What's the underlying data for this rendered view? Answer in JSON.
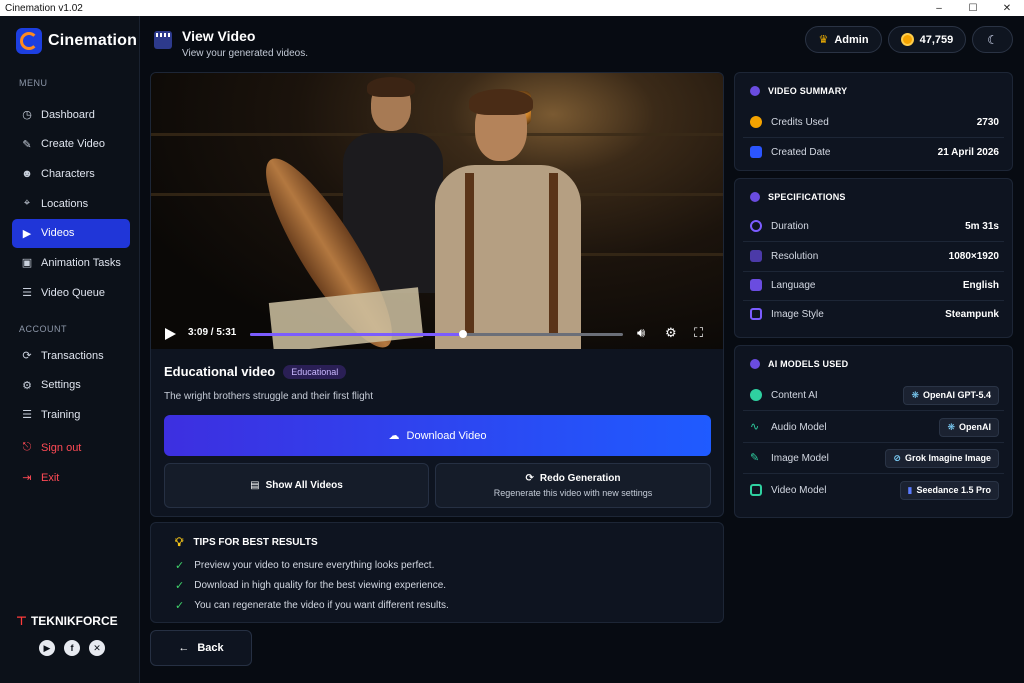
{
  "window": {
    "title": "Cinemation v1.02",
    "controls": [
      "–",
      "☐",
      "✕"
    ]
  },
  "sidebar": {
    "logo": "Cinemation",
    "menu_label": "MENU",
    "menu_items": [
      {
        "label": "Dashboard",
        "icon": "gauge-icon",
        "glyph": "◷"
      },
      {
        "label": "Create Video",
        "icon": "edit-icon",
        "glyph": "✎"
      },
      {
        "label": "Characters",
        "icon": "users-icon",
        "glyph": "☻"
      },
      {
        "label": "Locations",
        "icon": "location-pin-icon",
        "glyph": "⌖"
      },
      {
        "label": "Videos",
        "icon": "video-icon",
        "glyph": "▶",
        "active": true
      },
      {
        "label": "Animation Tasks",
        "icon": "image-icon",
        "glyph": "▣"
      },
      {
        "label": "Video Queue",
        "icon": "queue-icon",
        "glyph": "☰"
      }
    ],
    "account_label": "ACCOUNT",
    "account_items": [
      {
        "label": "Transactions",
        "icon": "transactions-icon",
        "glyph": "⟳"
      },
      {
        "label": "Settings",
        "icon": "gear-icon",
        "glyph": "⚙"
      },
      {
        "label": "Training",
        "icon": "training-icon",
        "glyph": "☰"
      }
    ],
    "signout_label": "Sign out",
    "exit_label": "Exit",
    "brand": {
      "prefix": "TEKNIK",
      "suffix": "FORCE"
    },
    "socials": [
      "youtube-icon",
      "facebook-icon",
      "x-icon"
    ]
  },
  "header": {
    "title": "View Video",
    "subtitle": "View your generated videos.",
    "user": "Admin",
    "credits": "47,759"
  },
  "player": {
    "time": "3:09 / 5:31",
    "progress": 0.571
  },
  "video": {
    "title": "Educational video",
    "tag": "Educational",
    "description": "The wright brothers struggle and their first flight",
    "download_label": "Download Video",
    "show_all_label": "Show All Videos",
    "redo_label": "Redo Generation",
    "redo_sub": "Regenerate this video with new settings"
  },
  "tips": {
    "title": "TIPS FOR BEST RESULTS",
    "items": [
      "Preview your video to ensure everything looks perfect.",
      "Download in high quality for the best viewing experience.",
      "You can regenerate the video if you want different results."
    ]
  },
  "back_label": "Back",
  "summary": {
    "title": "VIDEO SUMMARY",
    "rows": [
      {
        "label": "Credits Used",
        "value": "2730",
        "color": "#f5a300"
      },
      {
        "label": "Created Date",
        "value": "21 April 2026",
        "color": "#2b55ff"
      }
    ]
  },
  "specs": {
    "title": "SPECIFICATIONS",
    "rows": [
      {
        "label": "Duration",
        "value": "5m 31s",
        "color": "#7b5cff"
      },
      {
        "label": "Resolution",
        "value": "1080×1920",
        "color": "#7b5cff"
      },
      {
        "label": "Language",
        "value": "English",
        "color": "#7b5cff"
      },
      {
        "label": "Image Style",
        "value": "Steampunk",
        "color": "#7b5cff"
      }
    ]
  },
  "models": {
    "title": "AI MODELS USED",
    "rows": [
      {
        "label": "Content AI",
        "value": "OpenAI GPT-5.4",
        "color": "#2fd0a0"
      },
      {
        "label": "Audio Model",
        "value": "OpenAI",
        "color": "#2fd0a0"
      },
      {
        "label": "Image Model",
        "value": "Grok Imagine Image",
        "color": "#2fd0a0"
      },
      {
        "label": "Video Model",
        "value": "Seedance 1.5 Pro",
        "color": "#2fd0a0"
      }
    ]
  }
}
